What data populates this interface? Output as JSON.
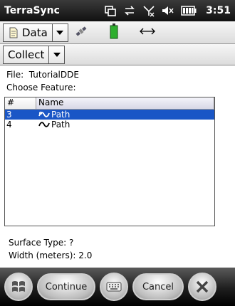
{
  "titlebar": {
    "app_title": "TerraSync",
    "clock": "3:51",
    "icons": [
      "data-connection-icon",
      "sync-icon",
      "no-signal-icon",
      "volume-muted-icon",
      "battery-icon"
    ]
  },
  "toolbar": {
    "section_dropdown": "Data",
    "section_dropdown_icon": "document-icon",
    "status_icons": [
      "satellite-icon",
      "battery-level-icon",
      "distance-arrow-icon"
    ],
    "mode_dropdown": "Collect"
  },
  "form": {
    "file_label": "File:",
    "file_value": "TutorialDDE",
    "choose_feature_label": "Choose Feature:",
    "columns": {
      "number": "#",
      "name": "Name"
    },
    "rows": [
      {
        "number": "3",
        "name": "Path",
        "selected": true,
        "icon": "line-feature-icon"
      },
      {
        "number": "4",
        "name": "Path",
        "selected": false,
        "icon": "line-feature-icon"
      }
    ],
    "surface_type": "Surface Type: ?",
    "width": "Width (meters): 2.0"
  },
  "softkeys": {
    "start": "windows-start-icon",
    "continue_label": "Continue",
    "keyboard": "keyboard-icon",
    "cancel_label": "Cancel",
    "close": "close-icon"
  },
  "colors": {
    "selection": "#1a56c6",
    "titlebar": "#111111",
    "softbar": "#000000"
  }
}
